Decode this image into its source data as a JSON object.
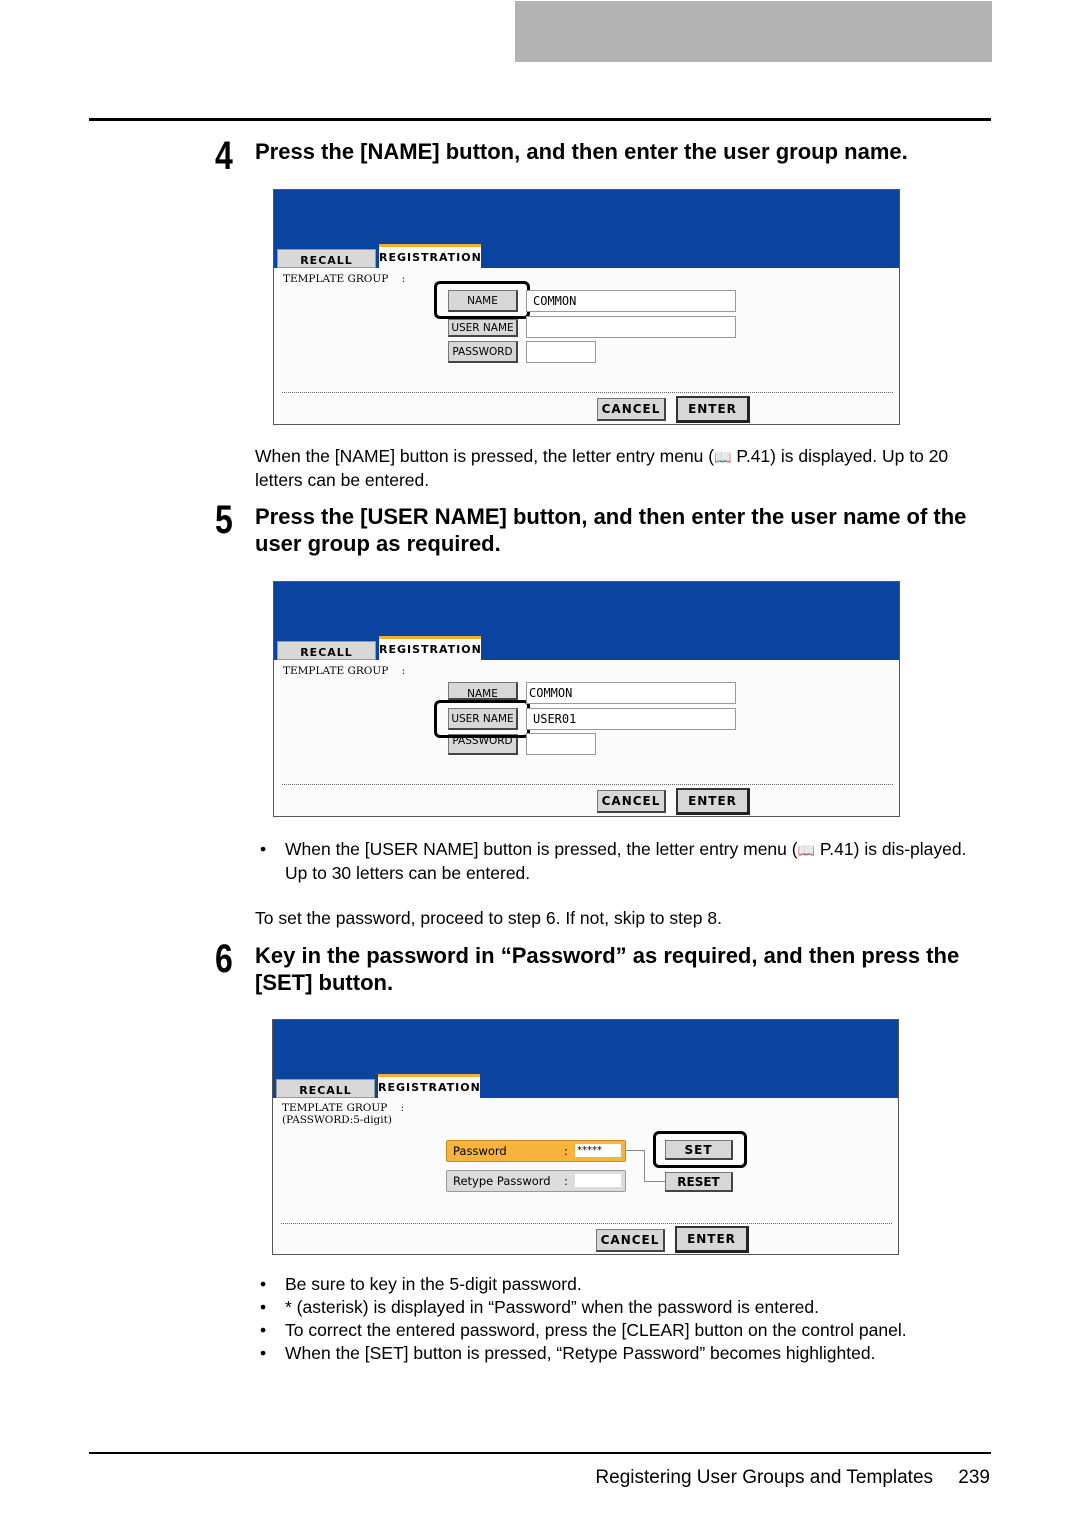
{
  "steps": [
    {
      "number": "4",
      "heading": "Press the [NAME] button, and then enter the user group name."
    },
    {
      "number": "5",
      "heading": "Press the [USER NAME] button, and then enter the user name of the user group as required."
    },
    {
      "number": "6",
      "heading": "Key in the password in “Password” as required, and then press the [SET] button."
    }
  ],
  "text": {
    "step4_note_a": "When the [NAME] button is pressed, the letter entry menu (",
    "step4_note_b": " P.41) is displayed. Up to 20 letters can be entered.",
    "step5_bullet_a": "When the [USER NAME] button is pressed, the letter entry menu (",
    "step5_bullet_b": " P.41) is dis-played. Up to 30 letters can be entered.",
    "step5_note": "To set the password, proceed to step 6. If not, skip to step 8.",
    "step6_bullets": [
      "Be sure to key in the 5-digit password.",
      " * (asterisk) is displayed in “Password” when the password is entered.",
      "To correct the entered password, press the [CLEAR] button on the control panel.",
      "When the [SET] button is pressed, “Retype Password” becomes highlighted."
    ],
    "book_icon": "📖"
  },
  "panel": {
    "tab_recall": "RECALL",
    "tab_registration": "REGISTRATION",
    "template_group": "TEMPLATE GROUP    :",
    "password_hint": "(PASSWORD:5-digit)",
    "name_btn": "NAME",
    "user_name_btn": "USER NAME",
    "password_btn": "PASSWORD",
    "cancel": "CANCEL",
    "enter": "ENTER",
    "set": "SET",
    "reset": "RESET",
    "password_label": "Password",
    "retype_label": "Retype Password",
    "colon": ":"
  },
  "screens": {
    "s4": {
      "name_value": "COMMON",
      "user_name_value": "",
      "password_value": ""
    },
    "s5": {
      "name_value": "COMMON",
      "user_name_value": "USER01",
      "password_value": ""
    },
    "s6": {
      "password_value": "*****",
      "retype_value": ""
    }
  },
  "colors": {
    "header_blue": "#0a44a0",
    "highlight_orange": "#f7b43c",
    "tab_accent": "#f0b030"
  },
  "footer": {
    "title": "Registering User Groups and Templates",
    "page": "239"
  }
}
